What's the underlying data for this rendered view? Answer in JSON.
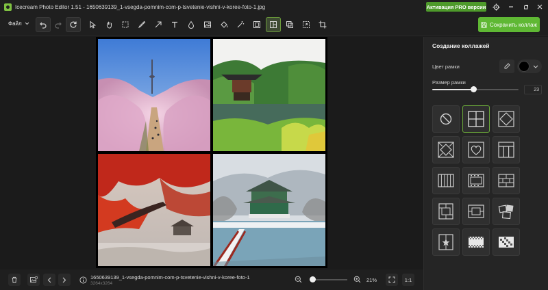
{
  "window": {
    "title": "Icecream Photo Editor 1.51 - 1650639139_1-vsegda-pomnim-com-p-tsvetenie-vishni-v-koree-foto-1.jpg",
    "pro_button": "Активация PRO версии"
  },
  "toolbar": {
    "file_menu": "Файл",
    "save_button": "Сохранить коллаж",
    "tools": [
      "undo-icon",
      "redo-icon",
      "reset-icon",
      "select-icon",
      "hand-icon",
      "marquee-icon",
      "brush-icon",
      "arrow-icon",
      "text-icon",
      "drop-icon",
      "image-icon",
      "fill-icon",
      "magic-wand-icon",
      "frame-icon",
      "collage-icon",
      "overlay-icon",
      "resize-icon",
      "crop-icon"
    ],
    "active_tool": "collage-icon"
  },
  "panel": {
    "title": "Создание коллажей",
    "frame_color_label": "Цвет рамки",
    "frame_color": "#000000",
    "frame_size_label": "Размер рамки",
    "frame_size_value": "23",
    "frame_size_fraction": 0.48,
    "layouts": [
      "none",
      "grid-2x2",
      "diamond",
      "diamond-frame",
      "heart",
      "columns-3",
      "columns-5",
      "film-strip",
      "bricks",
      "frame-grid",
      "stacked-frames",
      "scattered",
      "star-split",
      "checker-strip",
      "checker-diagonal"
    ],
    "selected_layout": "grid-2x2"
  },
  "status": {
    "file_name": "1650639139_1-vsegda-pomnim-com-p-tsvetenie-vishni-v-koree-foto-1",
    "dimensions": "3264x3264",
    "zoom": "21%",
    "zoom_fraction": 0.08,
    "actual_size": "1:1"
  },
  "colors": {
    "accent": "#5fb834",
    "pro": "#4e9a2b",
    "background": "#1b1b1b",
    "panel": "#252525"
  }
}
